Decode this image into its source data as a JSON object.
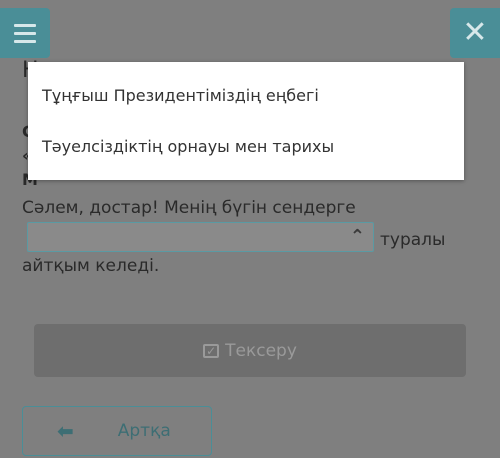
{
  "header": {
    "menu_icon": "hamburger-icon",
    "close_icon": "close-icon",
    "close_glyph": "✕",
    "heading_partial": "Н"
  },
  "question": {
    "line_prefix": "С",
    "line_quote": "«",
    "line_m": "М",
    "prompt": "Сәлем, достар! Менің бүгін сендерге",
    "after_select": "туралы",
    "line_end": "айтқым келеді."
  },
  "select": {
    "caret_icon": "chevron-up-icon",
    "caret_glyph": "⌃",
    "options": [
      "Тұңғыш Президентіміздің еңбегі",
      "Тәуелсіздіктің орнауы мен тарихы"
    ]
  },
  "buttons": {
    "check_label": "Тексеру",
    "check_icon": "check-square-icon",
    "back_label": "Артқа",
    "back_icon": "arrow-left-icon",
    "back_glyph": "⬅"
  }
}
